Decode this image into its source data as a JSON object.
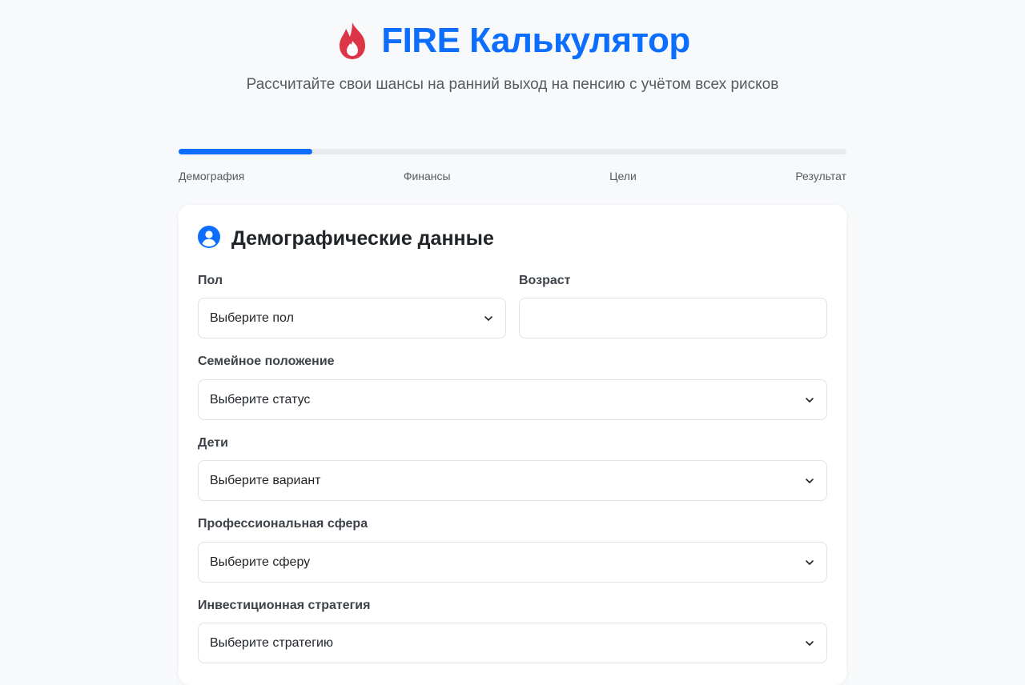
{
  "header": {
    "title": "FIRE Калькулятор",
    "subtitle": "Рассчитайте свои шансы на ранний выход на пенсию с учётом всех рисков",
    "icon": "fire-icon",
    "accent_color": "#0d6efd",
    "icon_color": "#dc3545"
  },
  "progress": {
    "value_percent": 20,
    "steps": [
      {
        "label": "Демография"
      },
      {
        "label": "Финансы"
      },
      {
        "label": "Цели"
      },
      {
        "label": "Результат"
      }
    ]
  },
  "card": {
    "icon": "user-circle-icon",
    "title": "Демографические данные",
    "fields": {
      "gender": {
        "label": "Пол",
        "value": "Выберите пол"
      },
      "age": {
        "label": "Возраст",
        "value": ""
      },
      "marital": {
        "label": "Семейное положение",
        "value": "Выберите статус"
      },
      "children": {
        "label": "Дети",
        "value": "Выберите вариант"
      },
      "profession": {
        "label": "Профессиональная сфера",
        "value": "Выберите сферу"
      },
      "strategy": {
        "label": "Инвестиционная стратегия",
        "value": "Выберите стратегию"
      }
    }
  }
}
